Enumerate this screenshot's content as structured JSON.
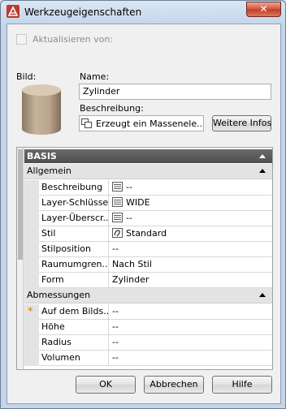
{
  "window": {
    "title": "Werkzeugeigenschaften",
    "close_label": "✕"
  },
  "update": {
    "label": "Aktualisieren von:",
    "checked": false
  },
  "image": {
    "label": "Bild:"
  },
  "name": {
    "label": "Name:",
    "value": "Zylinder"
  },
  "description": {
    "label": "Beschreibung:",
    "value": "Erzeugt ein Massenele...",
    "more_button": "Weitere Infos"
  },
  "grid": {
    "section": "BASIS",
    "categories": [
      {
        "label": "Allgemein",
        "rows": [
          {
            "name": "Beschreibung",
            "value": "--",
            "icon": "list-icon"
          },
          {
            "name": "Layer-Schlüssel",
            "value": "WIDE",
            "icon": "list-icon"
          },
          {
            "name": "Layer-Überscr...",
            "value": "--",
            "icon": "list-icon"
          },
          {
            "name": "Stil",
            "value": "Standard",
            "icon": "style-icon"
          },
          {
            "name": "Stilposition",
            "value": "--"
          },
          {
            "name": "Raumumgren...",
            "value": "Nach Stil"
          },
          {
            "name": "Form",
            "value": "Zylinder"
          }
        ]
      },
      {
        "label": "Abmessungen",
        "rows": [
          {
            "name": "Auf dem Bilds...",
            "value": "--",
            "marker": "*"
          },
          {
            "name": "Höhe",
            "value": "--"
          },
          {
            "name": "Radius",
            "value": "--"
          },
          {
            "name": "Volumen",
            "value": "--"
          }
        ]
      }
    ]
  },
  "buttons": {
    "ok": "OK",
    "cancel": "Abbrechen",
    "help": "Hilfe"
  },
  "colors": {
    "accent_marker": "#e07800",
    "section_header": "#5a5a5a"
  }
}
